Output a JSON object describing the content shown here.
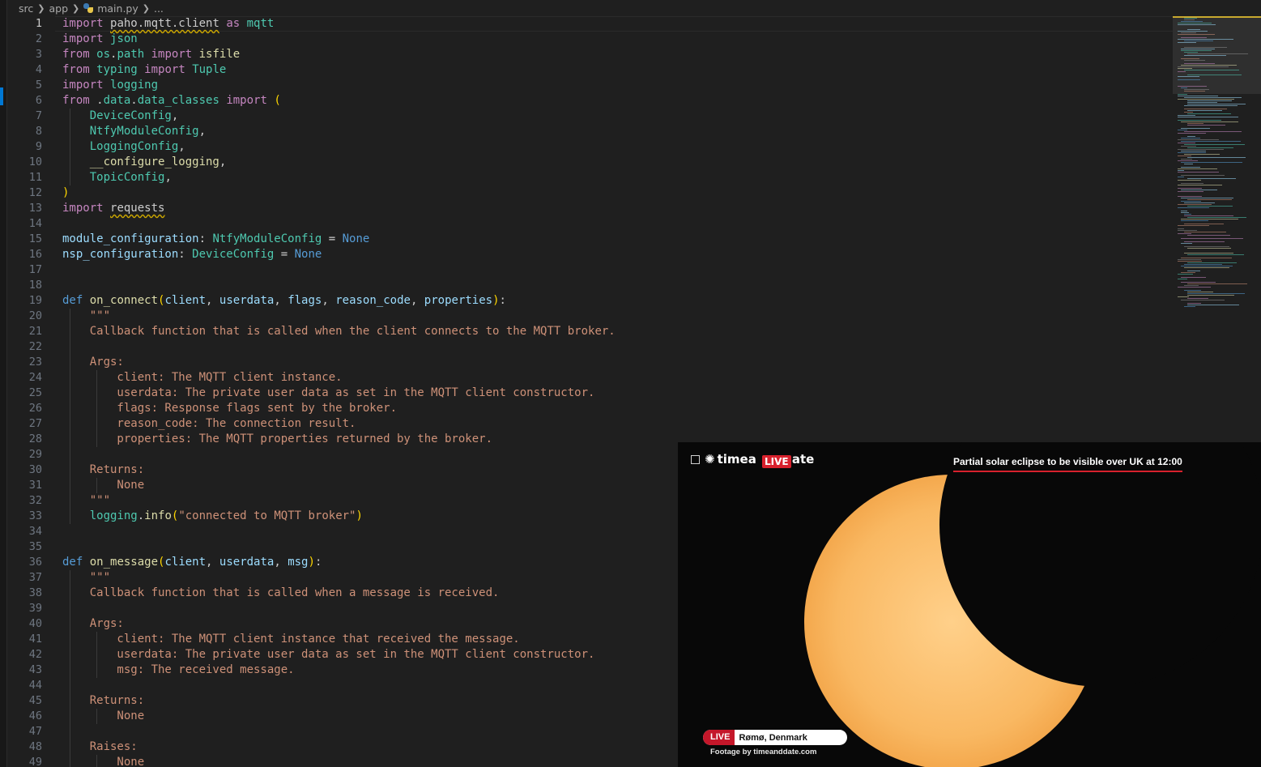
{
  "breadcrumb": {
    "items": [
      "src",
      "app",
      "main.py",
      "..."
    ]
  },
  "editor": {
    "active_line": 1,
    "lines": [
      [
        [
          "kw",
          "import"
        ],
        [
          "pl",
          " "
        ],
        [
          "sq",
          "paho.mqtt.client"
        ],
        [
          "pl",
          " "
        ],
        [
          "kw",
          "as"
        ],
        [
          "pl",
          " "
        ],
        [
          "cls",
          "mqtt"
        ]
      ],
      [
        [
          "kw",
          "import"
        ],
        [
          "pl",
          " "
        ],
        [
          "cls",
          "json"
        ]
      ],
      [
        [
          "kw",
          "from"
        ],
        [
          "pl",
          " "
        ],
        [
          "cls",
          "os"
        ],
        [
          "pl",
          "."
        ],
        [
          "cls",
          "path"
        ],
        [
          "pl",
          " "
        ],
        [
          "kw",
          "import"
        ],
        [
          "pl",
          " "
        ],
        [
          "fn",
          "isfile"
        ]
      ],
      [
        [
          "kw",
          "from"
        ],
        [
          "pl",
          " "
        ],
        [
          "cls",
          "typing"
        ],
        [
          "pl",
          " "
        ],
        [
          "kw",
          "import"
        ],
        [
          "pl",
          " "
        ],
        [
          "cls",
          "Tuple"
        ]
      ],
      [
        [
          "kw",
          "import"
        ],
        [
          "pl",
          " "
        ],
        [
          "cls",
          "logging"
        ]
      ],
      [
        [
          "kw",
          "from"
        ],
        [
          "pl",
          " ."
        ],
        [
          "cls",
          "data"
        ],
        [
          "pl",
          "."
        ],
        [
          "cls",
          "data_classes"
        ],
        [
          "pl",
          " "
        ],
        [
          "kw",
          "import"
        ],
        [
          "pl",
          " "
        ],
        [
          "br1",
          "("
        ]
      ],
      [
        [
          "pl",
          "    "
        ],
        [
          "cls",
          "DeviceConfig"
        ],
        [
          "pl",
          ","
        ]
      ],
      [
        [
          "pl",
          "    "
        ],
        [
          "cls",
          "NtfyModuleConfig"
        ],
        [
          "pl",
          ","
        ]
      ],
      [
        [
          "pl",
          "    "
        ],
        [
          "cls",
          "LoggingConfig"
        ],
        [
          "pl",
          ","
        ]
      ],
      [
        [
          "pl",
          "    "
        ],
        [
          "fn",
          "__configure_logging"
        ],
        [
          "pl",
          ","
        ]
      ],
      [
        [
          "pl",
          "    "
        ],
        [
          "cls",
          "TopicConfig"
        ],
        [
          "pl",
          ","
        ]
      ],
      [
        [
          "br1",
          ")"
        ]
      ],
      [
        [
          "kw",
          "import"
        ],
        [
          "pl",
          " "
        ],
        [
          "sq",
          "requests"
        ]
      ],
      [],
      [
        [
          "var",
          "module_configuration"
        ],
        [
          "pl",
          ": "
        ],
        [
          "cls",
          "NtfyModuleConfig"
        ],
        [
          "pl",
          " = "
        ],
        [
          "cst",
          "None"
        ]
      ],
      [
        [
          "var",
          "nsp_configuration"
        ],
        [
          "pl",
          ": "
        ],
        [
          "cls",
          "DeviceConfig"
        ],
        [
          "pl",
          " = "
        ],
        [
          "cst",
          "None"
        ]
      ],
      [],
      [],
      [
        [
          "def",
          "def"
        ],
        [
          "pl",
          " "
        ],
        [
          "fn",
          "on_connect"
        ],
        [
          "br1",
          "("
        ],
        [
          "prm",
          "client"
        ],
        [
          "pl",
          ", "
        ],
        [
          "prm",
          "userdata"
        ],
        [
          "pl",
          ", "
        ],
        [
          "prm",
          "flags"
        ],
        [
          "pl",
          ", "
        ],
        [
          "prm",
          "reason_code"
        ],
        [
          "pl",
          ", "
        ],
        [
          "prm",
          "properties"
        ],
        [
          "br1",
          ")"
        ],
        [
          "pl",
          ":"
        ]
      ],
      [
        [
          "pl",
          "    "
        ],
        [
          "str",
          "\"\"\""
        ]
      ],
      [
        [
          "str",
          "    Callback function that is called when the client connects to the MQTT broker."
        ]
      ],
      [],
      [
        [
          "str",
          "    Args:"
        ]
      ],
      [
        [
          "str",
          "        client: The MQTT client instance."
        ]
      ],
      [
        [
          "str",
          "        userdata: The private user data as set in the MQTT client constructor."
        ]
      ],
      [
        [
          "str",
          "        flags: Response flags sent by the broker."
        ]
      ],
      [
        [
          "str",
          "        reason_code: The connection result."
        ]
      ],
      [
        [
          "str",
          "        properties: The MQTT properties returned by the broker."
        ]
      ],
      [],
      [
        [
          "str",
          "    Returns:"
        ]
      ],
      [
        [
          "str",
          "        None"
        ]
      ],
      [
        [
          "str",
          "    \"\"\""
        ]
      ],
      [
        [
          "pl",
          "    "
        ],
        [
          "cls",
          "logging"
        ],
        [
          "pl",
          "."
        ],
        [
          "fn",
          "info"
        ],
        [
          "br1",
          "("
        ],
        [
          "str",
          "\"connected to MQTT broker\""
        ],
        [
          "br1",
          ")"
        ]
      ],
      [],
      [],
      [
        [
          "def",
          "def"
        ],
        [
          "pl",
          " "
        ],
        [
          "fn",
          "on_message"
        ],
        [
          "br1",
          "("
        ],
        [
          "prm",
          "client"
        ],
        [
          "pl",
          ", "
        ],
        [
          "prm",
          "userdata"
        ],
        [
          "pl",
          ", "
        ],
        [
          "prm",
          "msg"
        ],
        [
          "br1",
          ")"
        ],
        [
          "pl",
          ":"
        ]
      ],
      [
        [
          "pl",
          "    "
        ],
        [
          "str",
          "\"\"\""
        ]
      ],
      [
        [
          "str",
          "    Callback function that is called when a message is received."
        ]
      ],
      [],
      [
        [
          "str",
          "    Args:"
        ]
      ],
      [
        [
          "str",
          "        client: The MQTT client instance that received the message."
        ]
      ],
      [
        [
          "str",
          "        userdata: The private user data as set in the MQTT client constructor."
        ]
      ],
      [
        [
          "str",
          "        msg: The received message."
        ]
      ],
      [],
      [
        [
          "str",
          "    Returns:"
        ]
      ],
      [
        [
          "str",
          "        None"
        ]
      ],
      [],
      [
        [
          "str",
          "    Raises:"
        ]
      ],
      [
        [
          "str",
          "        None"
        ]
      ]
    ]
  },
  "video": {
    "logo_text": "timea",
    "logo_tail": "ate",
    "logo_live": "LIVE",
    "headline": "Partial solar eclipse to be visible over UK at 12:00",
    "live_badge": "LIVE",
    "location": "Rømø, Denmark",
    "footage_credit": "Footage by timeanddate.com"
  }
}
